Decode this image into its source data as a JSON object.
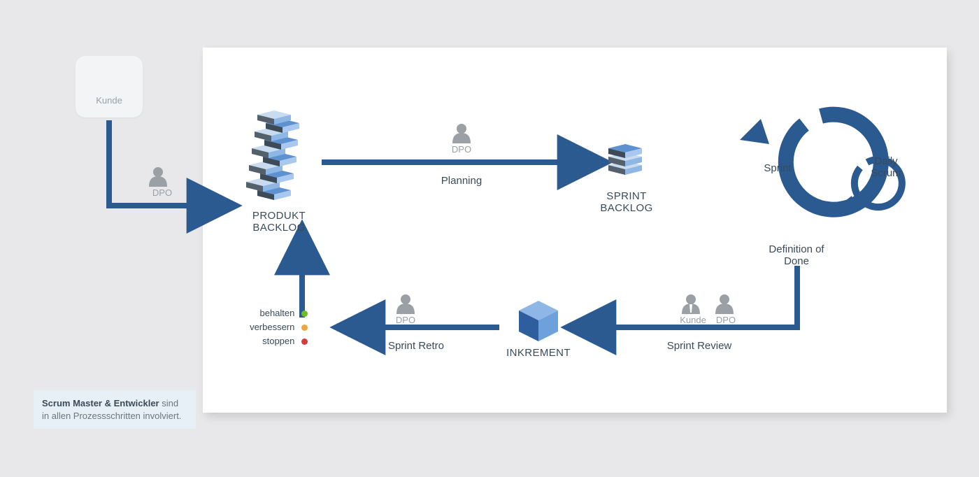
{
  "roles": {
    "kunde": "Kunde",
    "dpo": "DPO"
  },
  "nodes": {
    "produkt_backlog": "PRODUKT BACKLOG",
    "sprint_backlog": "SPRINT\nBACKLOG",
    "inkrement": "INKREMENT",
    "sprint": "Sprint",
    "daily_scrum": "Daily\nScrum",
    "definition_of_done": "Definition of\nDone"
  },
  "edges": {
    "planning": "Planning",
    "review": "Sprint Review",
    "retro": "Sprint Retro"
  },
  "retro_options": {
    "behalten": {
      "label": "behalten",
      "color": "#6cbf1f"
    },
    "verbessern": {
      "label": "verbessern",
      "color": "#f2a33a"
    },
    "stoppen": {
      "label": "stoppen",
      "color": "#d93a3a"
    }
  },
  "footnote": {
    "strong": "Scrum Master & Entwickler",
    "rest": " sind in allen Prozessschritten involviert."
  },
  "colors": {
    "arrow": "#2b5a91",
    "role": "#9aa0a6",
    "cube_light": "#a9c8ef",
    "cube_mid": "#5d91cf",
    "cube_dark": "#3d4a57"
  }
}
